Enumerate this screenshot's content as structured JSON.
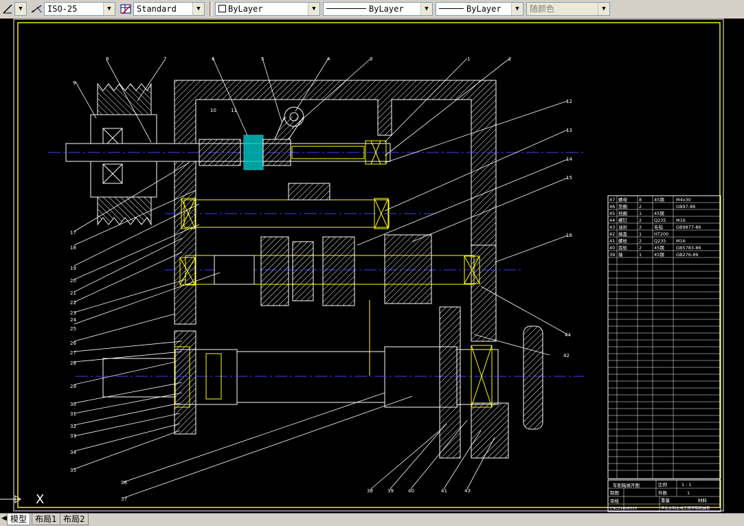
{
  "toolbar": {
    "dimstyle": "ISO-25",
    "tablestyle": "Standard",
    "layer": "ByLayer",
    "linetype": "ByLayer",
    "lineweight": "ByLayer",
    "color": "随颜色"
  },
  "tabs": [
    "模型",
    "布局1",
    "布局2"
  ],
  "ucs_label": "X",
  "balloons": [
    "1",
    "2",
    "3",
    "4",
    "5",
    "6",
    "7",
    "8",
    "9",
    "10",
    "11",
    "12",
    "13",
    "14",
    "15",
    "16",
    "17",
    "18",
    "19",
    "20",
    "21",
    "22",
    "23",
    "24",
    "25",
    "26",
    "27",
    "28",
    "29",
    "30",
    "31",
    "32",
    "33",
    "34",
    "35",
    "36",
    "37",
    "38",
    "39",
    "40",
    "41",
    "42",
    "43",
    "44"
  ],
  "bom_rows": [
    {
      "no": "47",
      "name": "螺母",
      "qty": "8",
      "mat": "45钢",
      "std": "M4x30"
    },
    {
      "no": "46",
      "name": "垫圈",
      "qty": "2",
      "mat": "",
      "std": "GB97-86"
    },
    {
      "no": "45",
      "name": "挡圈",
      "qty": "1",
      "mat": "45钢",
      "std": ""
    },
    {
      "no": "44",
      "name": "螺钉",
      "qty": "2",
      "mat": "Q235",
      "std": "M16"
    },
    {
      "no": "43",
      "name": "油封",
      "qty": "2",
      "mat": "毛毡",
      "std": "GB9877-86"
    },
    {
      "no": "42",
      "name": "端盖",
      "qty": "1",
      "mat": "HT200",
      "std": ""
    },
    {
      "no": "41",
      "name": "螺栓",
      "qty": "2",
      "mat": "Q235",
      "std": "M16"
    },
    {
      "no": "40",
      "name": "齿轮",
      "qty": "2",
      "mat": "45钢",
      "std": "GB5783-86"
    },
    {
      "no": "39",
      "name": "轴",
      "qty": "1",
      "mat": "45钢",
      "std": "GB276-89"
    }
  ],
  "title_block": {
    "drawing_name": "车削箱展开图",
    "scale_label": "比例",
    "scale": "1 : 1",
    "sheet_label": "件数",
    "sheet": "1",
    "designer_label": "制图",
    "checker_label": "审核",
    "weight_label": "重量",
    "material_label": "材料",
    "school": "华北水利水电工程学院机械系",
    "drawing_no": "CSC21406515"
  }
}
